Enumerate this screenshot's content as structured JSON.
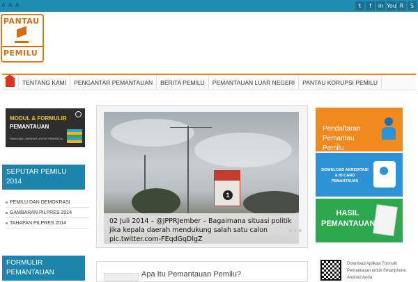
{
  "topbar": {
    "font_controls": "A A A",
    "social_icons": [
      "twitter-icon",
      "facebook-icon",
      "linkedin-icon",
      "youtube-icon",
      "rss-icon",
      "skype-icon"
    ],
    "social_glyphs": [
      "t",
      "f",
      "in",
      "You",
      "R",
      "S"
    ]
  },
  "logo": {
    "top_text": "PANTAU",
    "bottom_text": "PEMILU"
  },
  "nav": {
    "items": [
      "TENTANG KAMI",
      "PENGANTAR PEMANTAUAN",
      "BERITA PEMILU",
      "PEMANTAUAN LUAR NEGERI",
      "PANTAU KORUPSI PEMILU"
    ]
  },
  "left_sidebar": {
    "promo_line1": "MODUL & FORMULIR",
    "promo_line2": "PEMANTAUAN",
    "promo_sub": "PANDUAN LENGKAP UNTUK PEMANTAU",
    "section1_title": "SEPUTAR PEMILU 2014",
    "links": [
      "PEMILU DAN DEMOKRASI",
      "GAMBARAN PILPRES 2014",
      "TAHAPAN PILPRES 2014"
    ],
    "section2_title": "FORMULIR PEMANTAUAN"
  },
  "feature": {
    "caption": "02 Juli 2014 – @JPPRJember – Bagaimana situasi politik jika kepala daerah mendukung salah satu calon pic.twitter.com-FEqdGqDlgZ",
    "billboard_number": "1"
  },
  "article": {
    "title": "Apa Itu Pemantauan Pemilu?"
  },
  "right_sidebar": {
    "banner1": "Pendaftaran Pemantau Pemilu",
    "banner2": "DOWNLOAD AKREDITASI & ID CARD PEMANTAUAN",
    "banner3": "HASIL PEMANTAUAN",
    "app_text": "Download Aplikasi Formulir Pemantauan untuk Smartphone Android Anda"
  }
}
